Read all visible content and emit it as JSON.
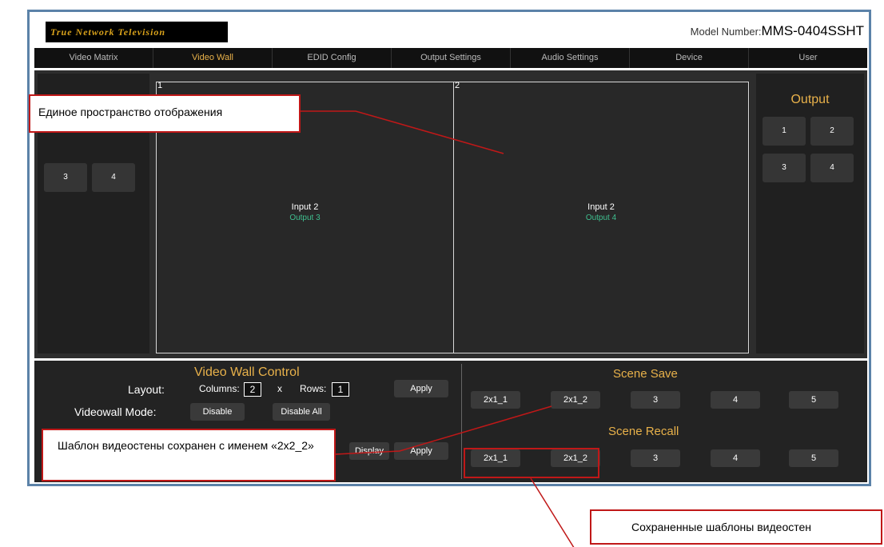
{
  "header": {
    "logo_text": "True Network Television",
    "model_label": "Model Number:",
    "model_value": "MMS-0404SSHT"
  },
  "nav": {
    "tabs": [
      "Video Matrix",
      "Video Wall",
      "EDID Config",
      "Output Settings",
      "Audio Settings",
      "Device",
      "User"
    ],
    "active": "Video Wall"
  },
  "input_panel": {
    "buttons": [
      "3",
      "4"
    ]
  },
  "output_panel": {
    "title": "Output",
    "buttons": [
      "1",
      "2",
      "3",
      "4"
    ]
  },
  "canvas": {
    "screens": [
      {
        "number": "1",
        "input": "Input 2",
        "output": "Output 3"
      },
      {
        "number": "2",
        "input": "Input 2",
        "output": "Output 4"
      }
    ]
  },
  "control": {
    "title": "Video Wall Control",
    "layout_label": "Layout:",
    "columns_label": "Columns:",
    "columns_value": "2",
    "x_label": "x",
    "rows_label": "Rows:",
    "rows_value": "1",
    "apply1": "Apply",
    "mode_label": "Videowall Mode:",
    "disable": "Disable",
    "disable_all": "Disable All",
    "display_btn": "Display",
    "apply2": "Apply"
  },
  "scene_save": {
    "title": "Scene Save",
    "buttons": [
      "2x1_1",
      "2x1_2",
      "3",
      "4",
      "5"
    ]
  },
  "scene_recall": {
    "title": "Scene Recall",
    "buttons": [
      "2x1_1",
      "2x1_2",
      "3",
      "4",
      "5"
    ]
  },
  "callouts": {
    "display_space": "Единое пространство отображения",
    "template_saved": "Шаблон видеостены сохранен с именем «2x2_2»",
    "saved_templates": "Сохраненные шаблоны видеостен"
  },
  "colors": {
    "accent": "#e8b14a",
    "output_text": "#3fbf8f",
    "callout_border": "#c01818",
    "frame_border": "#5b82a8"
  }
}
